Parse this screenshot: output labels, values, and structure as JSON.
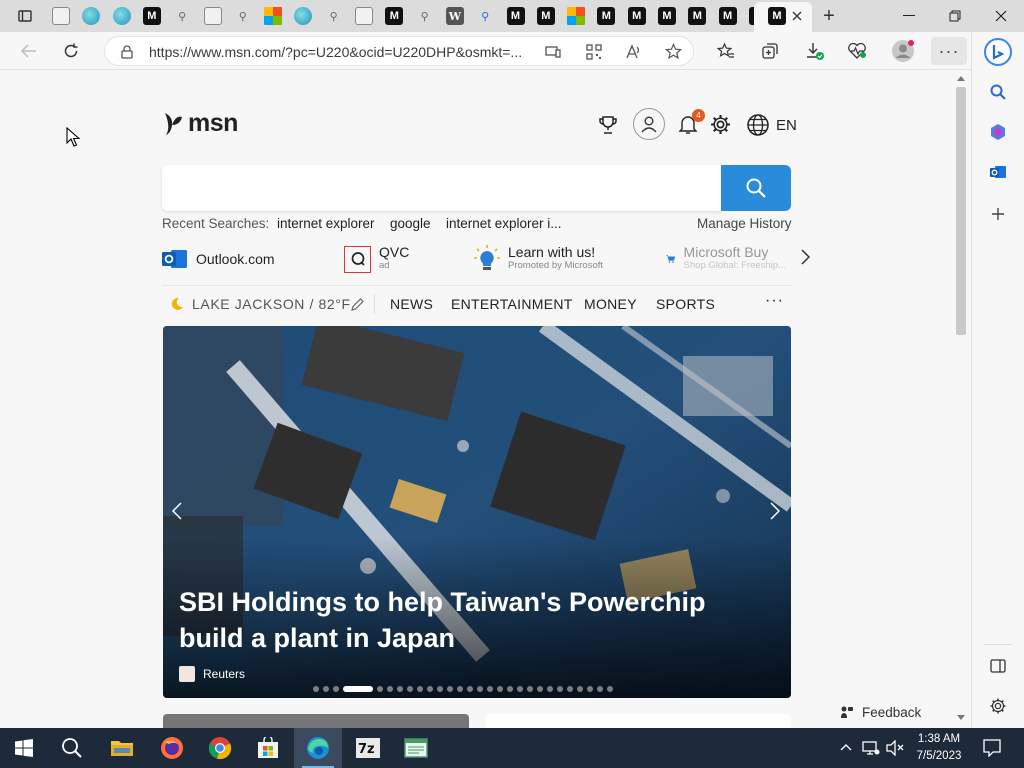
{
  "browser": {
    "tabs": [
      {
        "icon": "page-icon"
      },
      {
        "icon": "edge-icon"
      },
      {
        "icon": "edge-icon"
      },
      {
        "icon": "msn-icon"
      },
      {
        "icon": "search-icon"
      },
      {
        "icon": "page-icon"
      },
      {
        "icon": "search-icon"
      },
      {
        "icon": "image-icon"
      },
      {
        "icon": "edge-icon"
      },
      {
        "icon": "search-icon"
      },
      {
        "icon": "page-icon"
      },
      {
        "icon": "msn-icon"
      },
      {
        "icon": "search-icon"
      },
      {
        "icon": "wikipedia-icon"
      },
      {
        "icon": "bing-search-icon"
      },
      {
        "icon": "msn-icon"
      },
      {
        "icon": "msn-icon"
      },
      {
        "icon": "microsoft-icon"
      },
      {
        "icon": "msn-icon"
      },
      {
        "icon": "msn-icon"
      },
      {
        "icon": "msn-icon"
      },
      {
        "icon": "msn-icon"
      },
      {
        "icon": "msn-icon"
      },
      {
        "icon": "msn-icon"
      }
    ],
    "new_tab_label": "+",
    "address": {
      "url": "https://www.msn.com/?pc=U220&ocid=U220DHP&osmkt=..."
    }
  },
  "msn": {
    "brand": "msn",
    "notification_count": "4",
    "language": "EN",
    "search": {
      "placeholder": "",
      "recent_label": "Recent Searches:",
      "recent": [
        "internet explorer",
        "google",
        "internet explorer i..."
      ],
      "manage_history": "Manage History"
    },
    "quick_links": [
      {
        "label": "Outlook.com",
        "sub": ""
      },
      {
        "label": "QVC",
        "sub": "ad"
      },
      {
        "label": "Learn with us!",
        "sub": "Promoted by Microsoft"
      },
      {
        "label": "Microsoft Buy",
        "sub": "Shop Global: Freeship..."
      }
    ],
    "weather": "LAKE JACKSON / 82°F",
    "nav": [
      "NEWS",
      "ENTERTAINMENT",
      "MONEY",
      "SPORTS"
    ],
    "more": "···",
    "hero": {
      "title": "SBI Holdings to help Taiwan's Powerchip build a plant in Japan",
      "source": "Reuters",
      "slide_count": 28,
      "active_slide": 3
    },
    "feedback": "Feedback"
  },
  "taskbar": {
    "time": "1:38 AM",
    "date": "7/5/2023",
    "apps": [
      "start",
      "search",
      "file-explorer",
      "firefox",
      "chrome",
      "store",
      "edge",
      "7zip",
      "notepad"
    ]
  },
  "colors": {
    "accent": "#2a8bdb",
    "taskbar": "#1d2a3a"
  }
}
